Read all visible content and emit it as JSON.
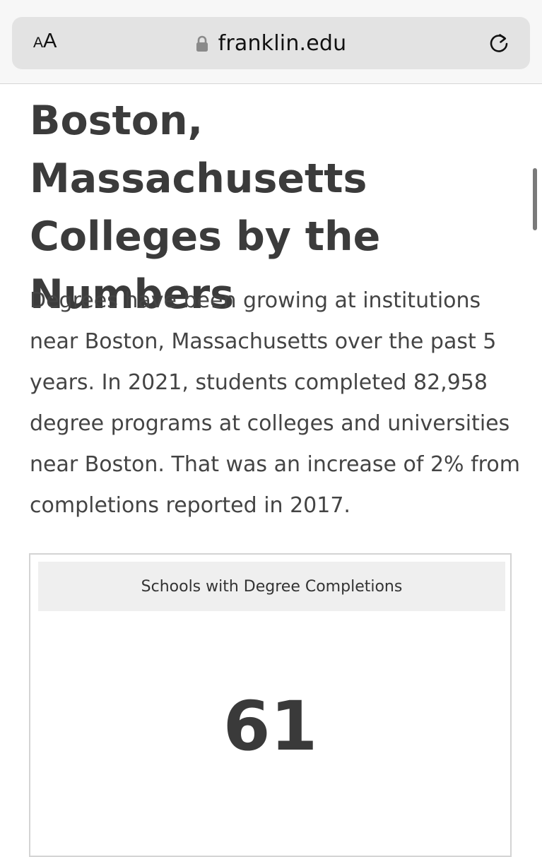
{
  "browser": {
    "text_size_small": "A",
    "text_size_big": "A",
    "url": "franklin.edu",
    "lock_icon": "lock-icon",
    "reload_icon": "reload-icon"
  },
  "page": {
    "title": "Boston, Massachusetts Colleges by the Numbers",
    "intro": "Degrees have been growing at institutions near Boston, Massachusetts over the past 5 years. In 2021, students completed 82,958 degree programs at colleges and universities near Boston. That was an increase of 2% from completions reported in 2017."
  },
  "stat_card": {
    "label": "Schools with Degree Completions",
    "value": "61"
  }
}
